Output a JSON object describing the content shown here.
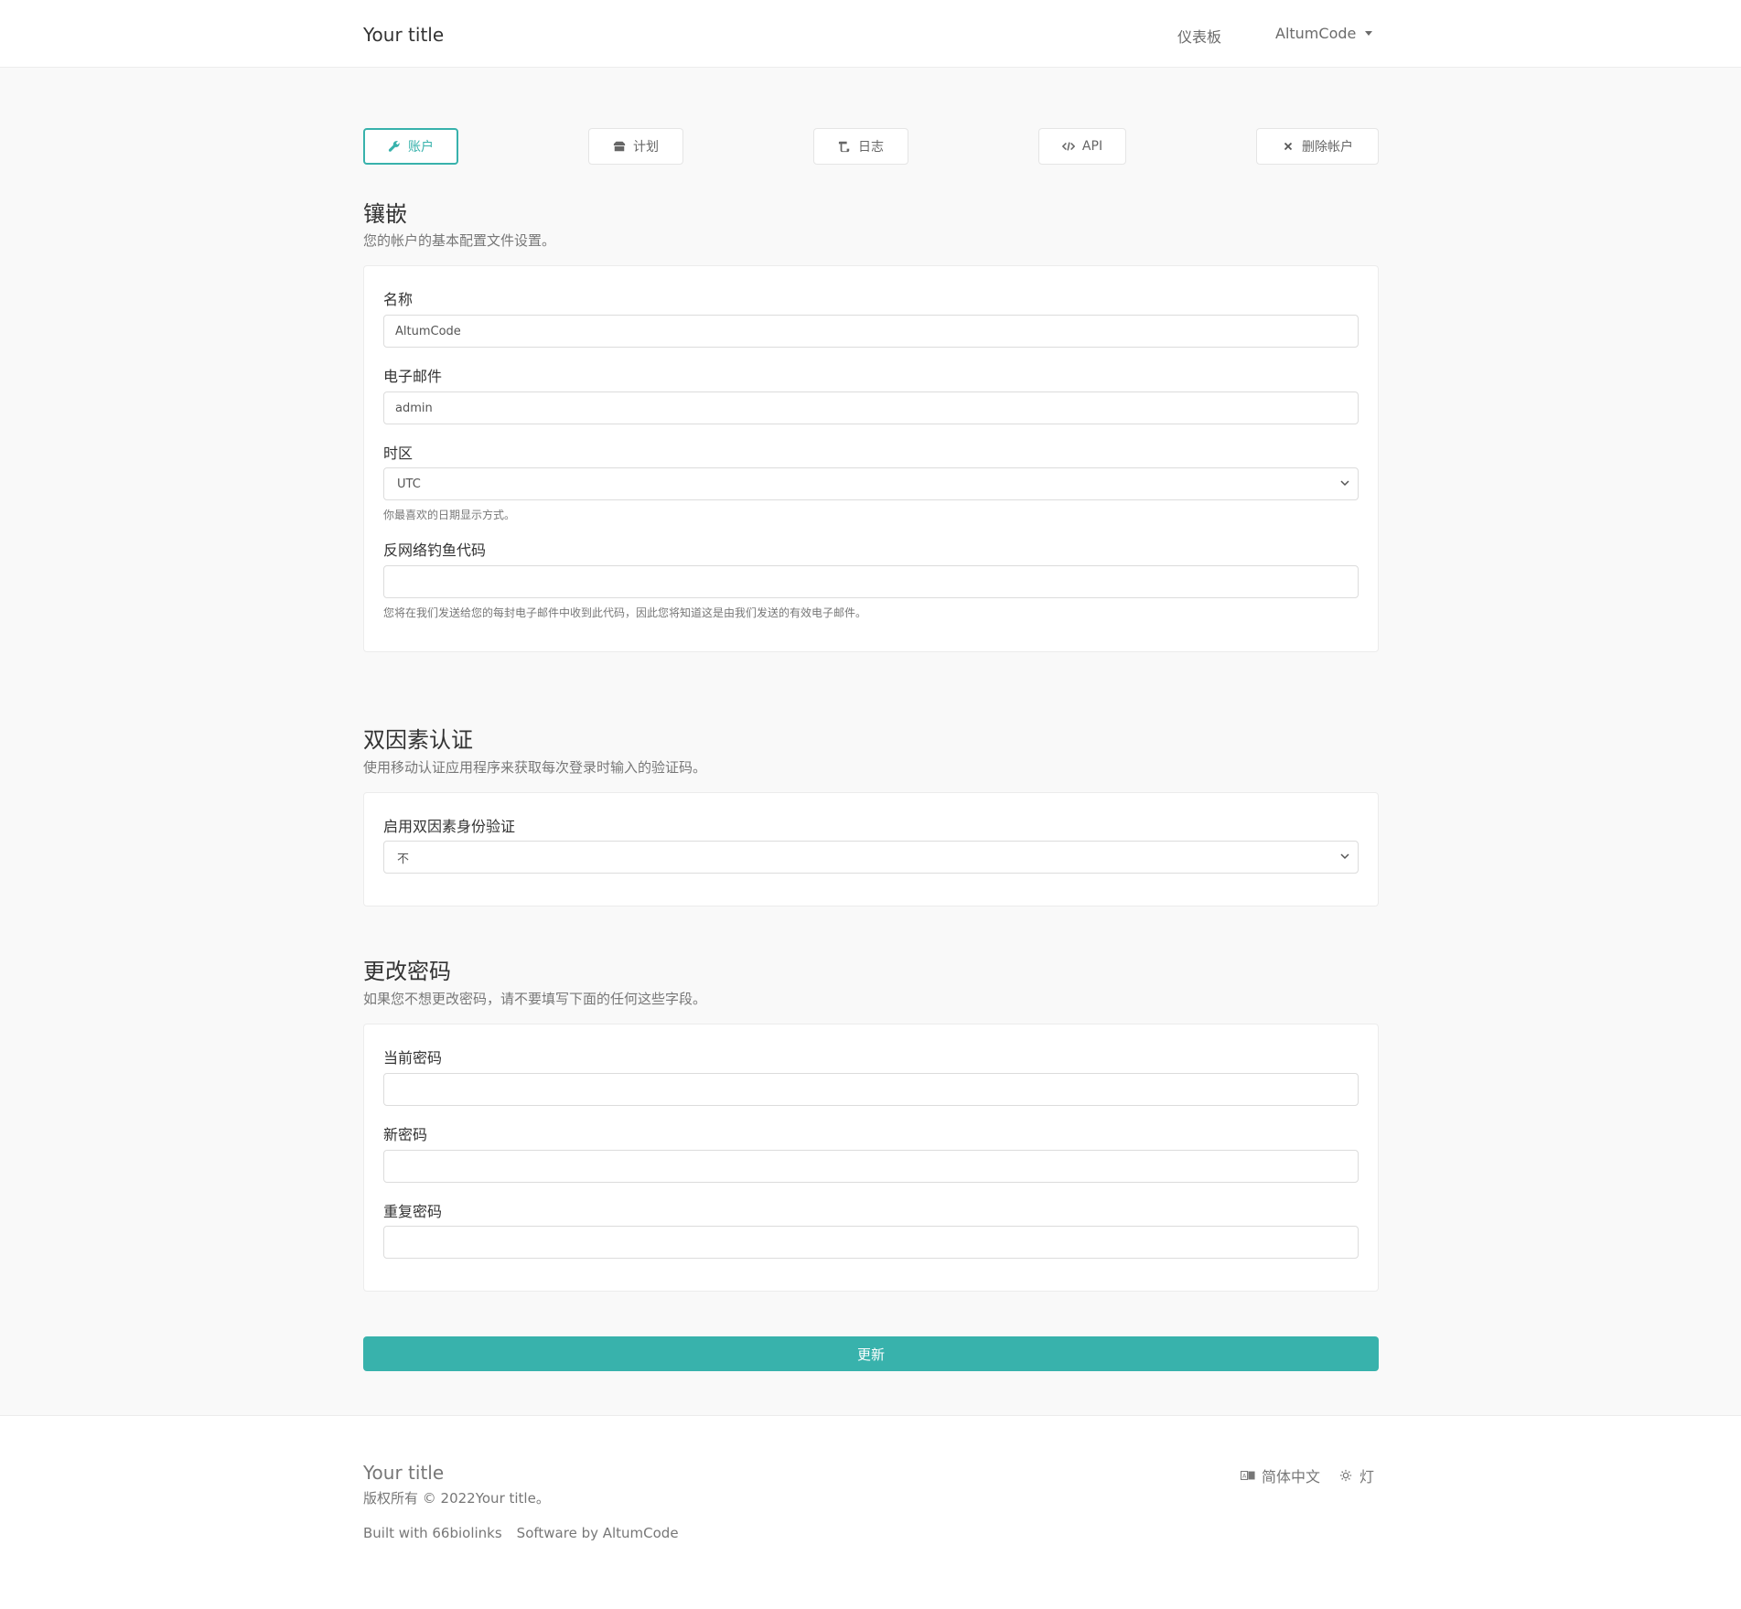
{
  "header": {
    "brand": "Your title",
    "nav_dashboard": "仪表板",
    "nav_user": "AltumCode"
  },
  "tabs": [
    {
      "label": "账户",
      "icon": "wrench-icon",
      "active": true
    },
    {
      "label": "计划",
      "icon": "box-icon",
      "active": false
    },
    {
      "label": "日志",
      "icon": "scroll-icon",
      "active": false
    },
    {
      "label": "API",
      "icon": "code-icon",
      "active": false
    },
    {
      "label": "删除帐户",
      "icon": "times-icon",
      "active": false
    }
  ],
  "profile": {
    "title": "镶嵌",
    "subtitle": "您的帐户的基本配置文件设置。",
    "name_label": "名称",
    "name_value": "AltumCode",
    "email_label": "电子邮件",
    "email_value": "admin",
    "timezone_label": "时区",
    "timezone_value": "UTC",
    "timezone_help": "你最喜欢的日期显示方式。",
    "anti_phishing_label": "反网络钓鱼代码",
    "anti_phishing_value": "",
    "anti_phishing_help": "您将在我们发送给您的每封电子邮件中收到此代码，因此您将知道这是由我们发送的有效电子邮件。"
  },
  "twofa": {
    "title": "双因素认证",
    "subtitle": "使用移动认证应用程序来获取每次登录时输入的验证码。",
    "enable_label": "启用双因素身份验证",
    "enable_value": "不"
  },
  "password": {
    "title": "更改密码",
    "subtitle": "如果您不想更改密码，请不要填写下面的任何这些字段。",
    "current_label": "当前密码",
    "new_label": "新密码",
    "repeat_label": "重复密码"
  },
  "update_label": "更新",
  "footer": {
    "brand": "Your title",
    "copyright": "版权所有 © 2022Your title。",
    "built_with": "Built with 66biolinks",
    "software_by": "Software by AltumCode",
    "language": "简体中文",
    "theme": "灯"
  },
  "colors": {
    "accent": "#38b2ac",
    "background": "#f9f9f9"
  }
}
